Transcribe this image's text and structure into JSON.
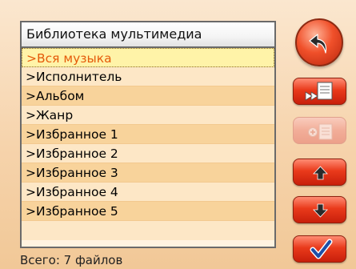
{
  "library": {
    "title": "Библиотека мультимедиа",
    "items": [
      {
        "label": ">Вся музыка"
      },
      {
        "label": ">Исполнитель"
      },
      {
        "label": ">Альбом"
      },
      {
        "label": ">Жанр"
      },
      {
        "label": ">Избранное 1"
      },
      {
        "label": ">Избранное 2"
      },
      {
        "label": ">Избранное 3"
      },
      {
        "label": ">Избранное 4"
      },
      {
        "label": ">Избранное 5"
      }
    ],
    "selected_index": 0
  },
  "status": {
    "text": "Всего: 7 файлов"
  },
  "buttons": {
    "back": {
      "icon": "back-arrow-icon"
    },
    "playlist_remove": {
      "icon": "playlist-rewind-icon",
      "enabled": true
    },
    "playlist_add": {
      "icon": "playlist-add-icon",
      "enabled": false
    },
    "move_up": {
      "icon": "arrow-up-icon",
      "enabled": true
    },
    "move_down": {
      "icon": "arrow-down-icon",
      "enabled": true
    },
    "confirm": {
      "icon": "checkmark-icon",
      "enabled": true
    }
  },
  "colors": {
    "accent": "#e93a1b",
    "selected_text": "#e55a0a",
    "selected_bg": "#fff3a8"
  }
}
